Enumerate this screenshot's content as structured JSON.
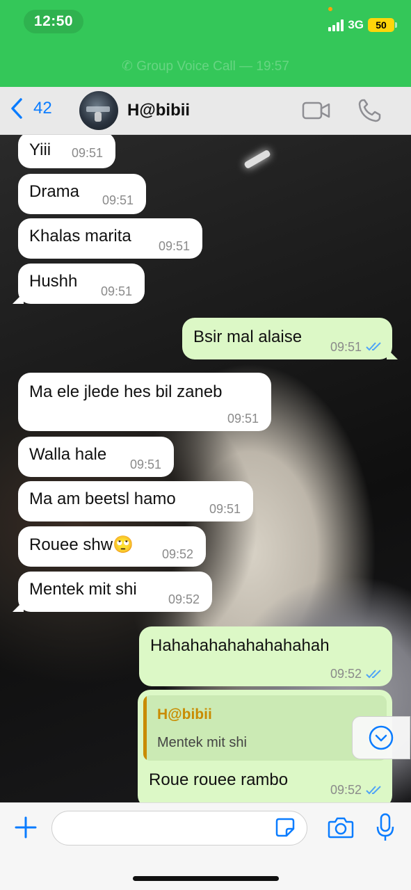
{
  "status_bar": {
    "time": "12:50",
    "network": "3G",
    "battery": "50"
  },
  "call_banner": "Group Voice Call — 19:57",
  "header": {
    "back_count": "42",
    "contact_name": "H@bibii"
  },
  "messages": [
    {
      "direction": "in",
      "text": "Yiii",
      "time": "09:51"
    },
    {
      "direction": "in",
      "text": "Drama",
      "time": "09:51"
    },
    {
      "direction": "in",
      "text": "Khalas marita",
      "time": "09:51"
    },
    {
      "direction": "in",
      "text": "Hushh",
      "time": "09:51"
    },
    {
      "direction": "out",
      "text": "Bsir mal alaise",
      "time": "09:51",
      "read": true
    },
    {
      "direction": "in",
      "text": "Ma ele jlede hes bil zaneb",
      "time": "09:51"
    },
    {
      "direction": "in",
      "text": "Walla hale",
      "time": "09:51"
    },
    {
      "direction": "in",
      "text": "Ma am beetsl hamo",
      "time": "09:51"
    },
    {
      "direction": "in",
      "text": "Rouee shw🙄",
      "time": "09:52"
    },
    {
      "direction": "in",
      "text": "Mentek mit shi",
      "time": "09:52"
    },
    {
      "direction": "out",
      "text": "Hahahahahahahahahah",
      "time": "09:52",
      "read": true
    },
    {
      "direction": "out",
      "text": "Roue rouee rambo",
      "time": "09:52",
      "read": true,
      "reply_to": {
        "name": "H@bibii",
        "text": "Mentek mit shi"
      }
    }
  ],
  "input": {
    "value": "",
    "placeholder": ""
  },
  "colors": {
    "status_green": "#34c759",
    "accent_blue": "#0a7cff",
    "outgoing_bubble": "#dcf8c6",
    "incoming_bubble": "#ffffff",
    "reply_name": "#c98b00"
  }
}
